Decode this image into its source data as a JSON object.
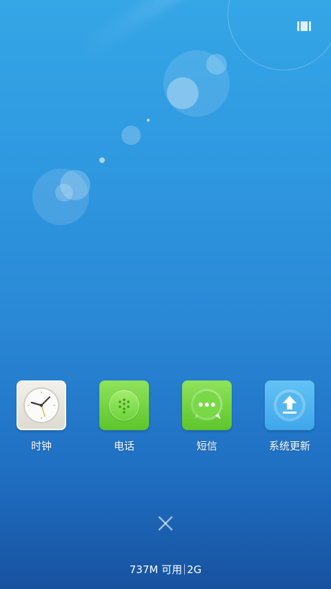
{
  "apps": [
    {
      "label": "时钟",
      "icon": "clock-icon"
    },
    {
      "label": "电话",
      "icon": "phone-icon"
    },
    {
      "label": "短信",
      "icon": "message-icon"
    },
    {
      "label": "系统更新",
      "icon": "update-icon"
    }
  ],
  "memory": {
    "available": "737M 可用",
    "total": "2G"
  },
  "colors": {
    "wallpaper_top": "#35a6e6",
    "wallpaper_bottom": "#17529f",
    "app_green": "#6ad33a",
    "app_blue": "#3ea6ea"
  }
}
